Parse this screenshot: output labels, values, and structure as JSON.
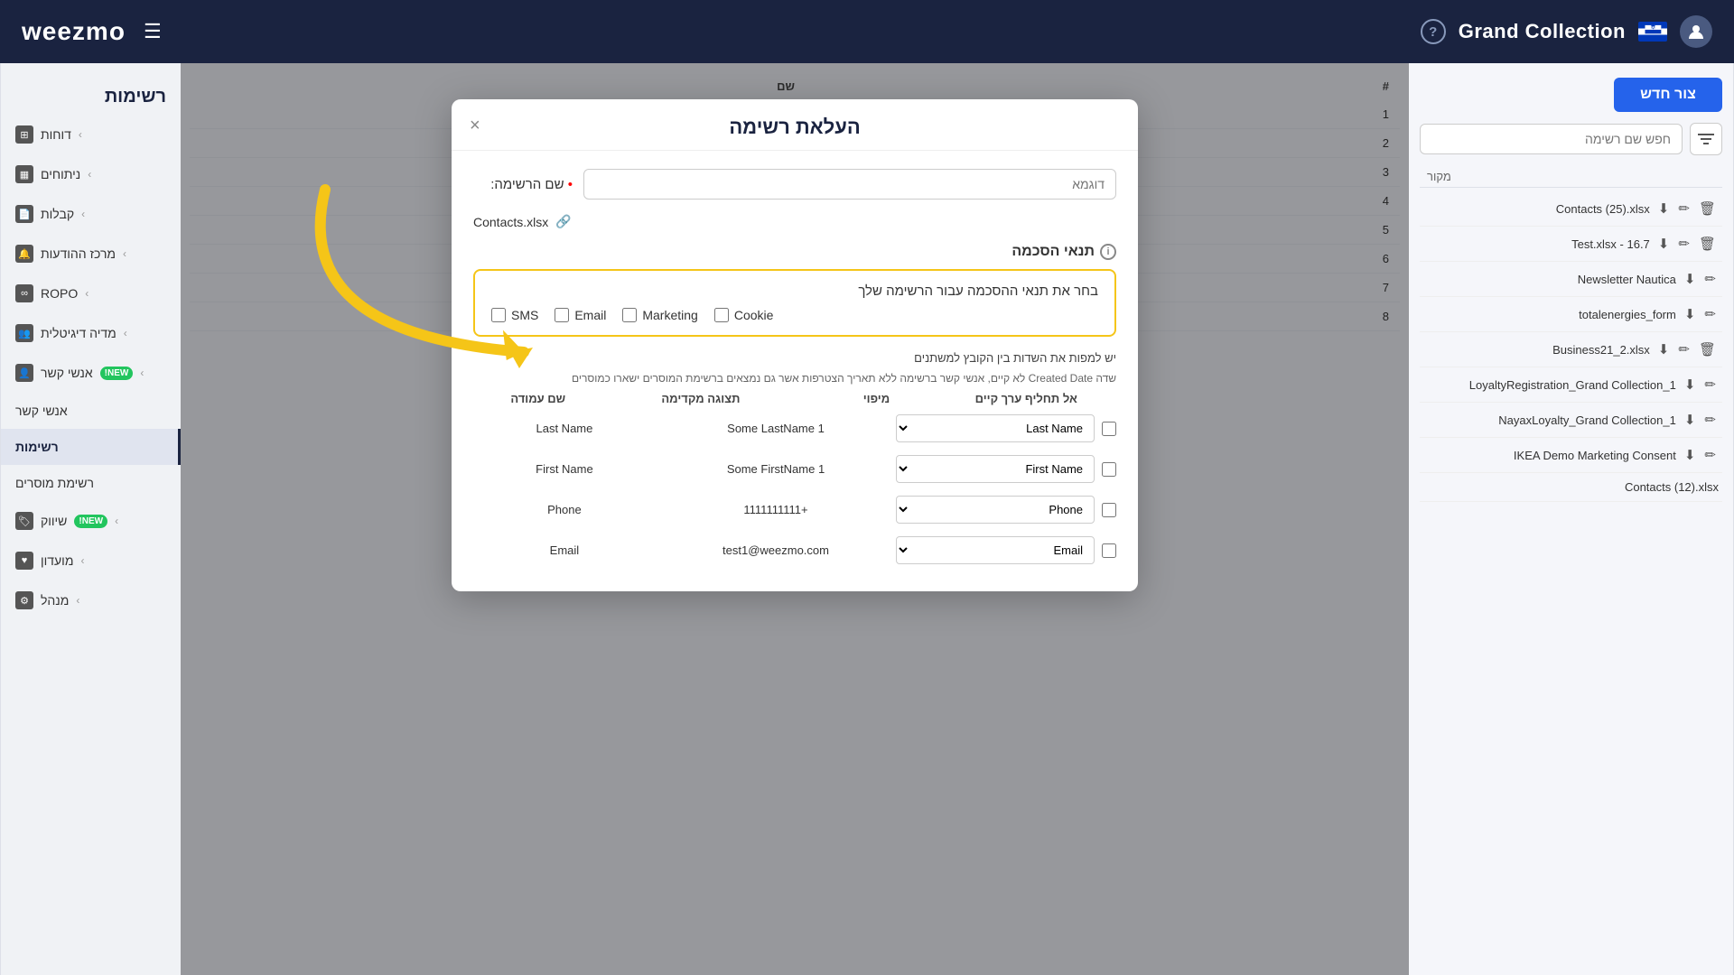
{
  "topbar": {
    "title": "Grand Collection",
    "help_label": "?",
    "brand": "weezmo"
  },
  "sidebar": {
    "section_title": "רשימות",
    "items": [
      {
        "id": "reports",
        "label": "דוחות",
        "icon": "grid",
        "active": false,
        "badge": null
      },
      {
        "id": "analytics",
        "label": "ניתוחים",
        "icon": "chart",
        "active": false,
        "badge": null
      },
      {
        "id": "receipts",
        "label": "קבלות",
        "icon": "receipt",
        "active": false,
        "badge": null
      },
      {
        "id": "notification-center",
        "label": "מרכז ההודעות",
        "icon": "bell",
        "active": false,
        "badge": null
      },
      {
        "id": "ropo",
        "label": "ROPO",
        "icon": "infinity",
        "active": false,
        "badge": null
      },
      {
        "id": "digital-media",
        "label": "מדיה דיגיטלית",
        "icon": "users",
        "active": false,
        "badge": null
      },
      {
        "id": "contacts",
        "label": "אנשי קשר",
        "icon": "person",
        "active": false,
        "badge": "NEW!"
      },
      {
        "id": "contacts2",
        "label": "אנשי קשר",
        "icon": "person",
        "active": false,
        "badge": null
      },
      {
        "id": "lists",
        "label": "רשימות",
        "icon": "list",
        "active": true,
        "badge": null
      },
      {
        "id": "suppliers",
        "label": "רשימת מוסרים",
        "icon": "list2",
        "active": false,
        "badge": null
      },
      {
        "id": "marketing",
        "label": "שיווק",
        "icon": "tag",
        "active": false,
        "badge": "NEW!"
      },
      {
        "id": "club",
        "label": "מועדון",
        "icon": "heart",
        "active": false,
        "badge": null
      },
      {
        "id": "manager",
        "label": "מנהל",
        "icon": "gear",
        "active": false,
        "badge": null
      }
    ]
  },
  "left_panel": {
    "new_button": "צור חדש",
    "search_placeholder": "חפש שם רשימה",
    "column_header": "מקור",
    "files": [
      {
        "name": "Contacts (25).xlsx",
        "has_delete": true,
        "has_edit": true,
        "has_download": true
      },
      {
        "name": "Test.xlsx - 16.7",
        "has_delete": true,
        "has_edit": true,
        "has_download": true
      },
      {
        "name": "Newsletter Nautica",
        "has_delete": false,
        "has_edit": true,
        "has_download": true
      },
      {
        "name": "totalenergies_form",
        "has_delete": false,
        "has_edit": true,
        "has_download": true
      },
      {
        "name": "Business21_2.xlsx",
        "has_delete": true,
        "has_edit": true,
        "has_download": true
      },
      {
        "name": "LoyaltyRegistration_Grand Collection_1",
        "has_delete": false,
        "has_edit": true,
        "has_download": true
      },
      {
        "name": "NayaxLoyalty_Grand Collection_1",
        "has_delete": false,
        "has_edit": true,
        "has_download": true
      },
      {
        "name": "IKEA Demo Marketing Consent",
        "has_delete": false,
        "has_edit": true,
        "has_download": true
      },
      {
        "name": "Contacts (12).xlsx",
        "has_delete": false,
        "has_edit": false,
        "has_download": false
      }
    ]
  },
  "modal": {
    "title": "העלאת רשימה",
    "close_label": "×",
    "list_name_label": "שם הרשימה:",
    "list_name_required": "•",
    "list_name_placeholder": "דוגמא",
    "file_name": "Contacts.xlsx",
    "consent_section_title": "תנאי הסכמה",
    "consent_box_instruction": "בחר את תנאי ההסכמה עבור הרשימה שלך",
    "consent_options": [
      {
        "id": "cookie",
        "label": "Cookie",
        "checked": false
      },
      {
        "id": "marketing",
        "label": "Marketing",
        "checked": false
      },
      {
        "id": "email",
        "label": "Email",
        "checked": false
      },
      {
        "id": "sms",
        "label": "SMS",
        "checked": false
      }
    ],
    "warning_text": "יש למפות את השדות בין הקובץ למשתנים",
    "warning_detail": "שדה Created Date לא קיים, אנשי קשר ברשימה ללא תאריך הצטרפות אשר גם נמצאים ברשימת המוסרים ישארו כמוסרים",
    "not_replace_label": "אל תחליף ערך קיים",
    "mapping": {
      "col_not_replace": "אל תחליף ערך קיים",
      "col_mifui": "מיפוי",
      "col_prev": "תצוגה מקדימה",
      "col_field": "שם עמודה",
      "rows": [
        {
          "field": "Last Name",
          "preview": "Some LastName 1",
          "mapped": "Last Name"
        },
        {
          "field": "First Name",
          "preview": "Some FirstName 1",
          "mapped": "First Name"
        },
        {
          "field": "Phone",
          "preview": "+1111111111",
          "mapped": "Phone"
        },
        {
          "field": "Email",
          "preview": "test1@weezmo.com",
          "mapped": "Email"
        }
      ]
    }
  },
  "right_table": {
    "col_num": "#",
    "col_name": "שם",
    "rows": [
      {
        "num": 1,
        "name": ""
      },
      {
        "num": 2,
        "name": ""
      },
      {
        "num": 3,
        "name": ""
      },
      {
        "num": 4,
        "name": ""
      },
      {
        "num": 5,
        "name": ""
      },
      {
        "num": 6,
        "name": ""
      },
      {
        "num": 7,
        "name": ""
      },
      {
        "num": 8,
        "name": ""
      }
    ]
  },
  "annotation": {
    "arrow_color": "#f5c518"
  }
}
